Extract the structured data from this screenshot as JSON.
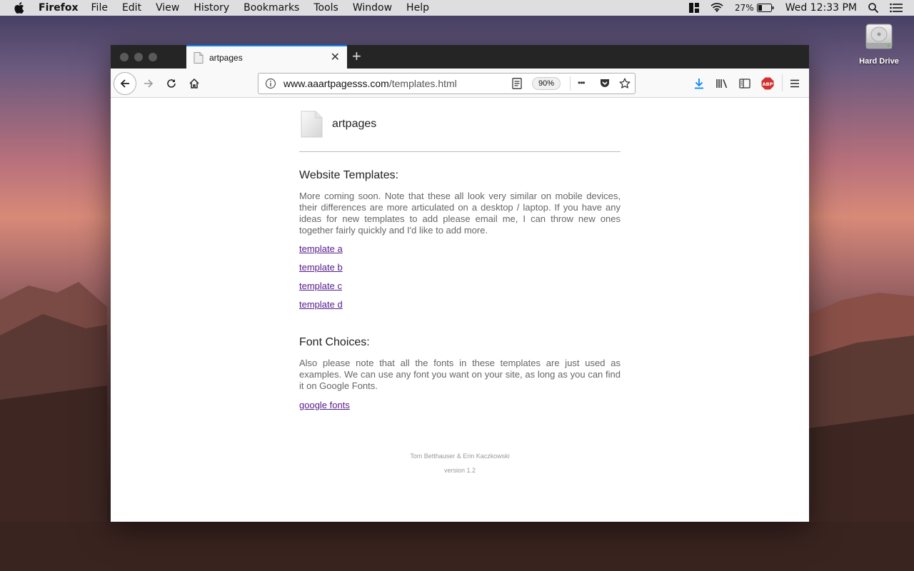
{
  "menubar": {
    "app_name": "Firefox",
    "items": [
      "File",
      "Edit",
      "View",
      "History",
      "Bookmarks",
      "Tools",
      "Window",
      "Help"
    ],
    "battery_percent": "27%",
    "clock": "Wed 12:33 PM"
  },
  "desktop": {
    "hard_drive_label": "Hard Drive"
  },
  "browser": {
    "tab_title": "artpages",
    "url_host": "www.aaartpagesss.com",
    "url_path": "/templates.html",
    "zoom": "90%",
    "more_glyph": "•••",
    "accent": "#0a84ff"
  },
  "page": {
    "site_name": "artpages",
    "templates_heading": "Website Templates:",
    "templates_text": "More coming soon. Note that these all look very similar on mobile devices, their differences are more articulated on a desktop / laptop. If you have any ideas for new templates to add please email me, I can throw new ones together fairly quickly and I'd like to add more.",
    "template_links": [
      "template a",
      "template b",
      "template c",
      "template d"
    ],
    "fonts_heading": "Font Choices:",
    "fonts_text": "Also please note that all the fonts in these templates are just used as examples. We can use any font you want on your site, as long as you can find it on Google Fonts.",
    "fonts_link": "google fonts",
    "footer_authors": "Tom Betthauser & Erin Kaczkowski",
    "footer_version": "version 1.2",
    "link_color": "#551a8b"
  }
}
